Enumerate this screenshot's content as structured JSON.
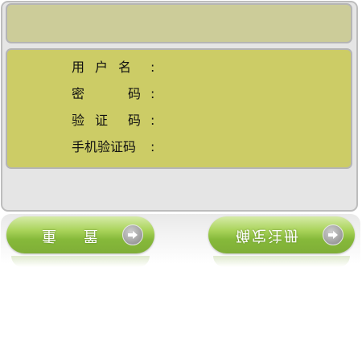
{
  "form": {
    "username_label": "用户名",
    "password_label": "密码",
    "captcha_label": "验证码",
    "sms_code_label": "手机验证码",
    "colon": ":"
  },
  "buttons": {
    "reset_label": "重 置",
    "submit_label": "确定注册"
  },
  "icons": {
    "button_arrow": "arrow-right-icon"
  },
  "colors": {
    "header": "#cccc99",
    "form_panel": "#cccc66",
    "button_green": "#86b93a"
  }
}
